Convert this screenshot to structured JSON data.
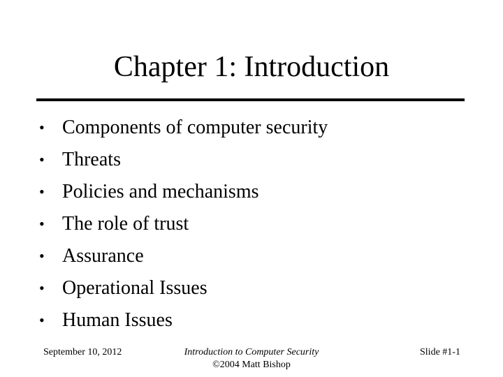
{
  "slide": {
    "title": "Chapter 1: Introduction",
    "bullet_glyph": "•",
    "bullets": [
      {
        "text": "Components of computer security"
      },
      {
        "text": "Threats"
      },
      {
        "text": "Policies and mechanisms"
      },
      {
        "text": "The role of trust"
      },
      {
        "text": "Assurance"
      },
      {
        "text": "Operational Issues"
      },
      {
        "text": "Human Issues"
      }
    ],
    "footer": {
      "date": "September 10, 2012",
      "course": "Introduction to Computer Security",
      "copyright": "©2004 Matt Bishop",
      "slide_number": "Slide #1-1"
    }
  }
}
